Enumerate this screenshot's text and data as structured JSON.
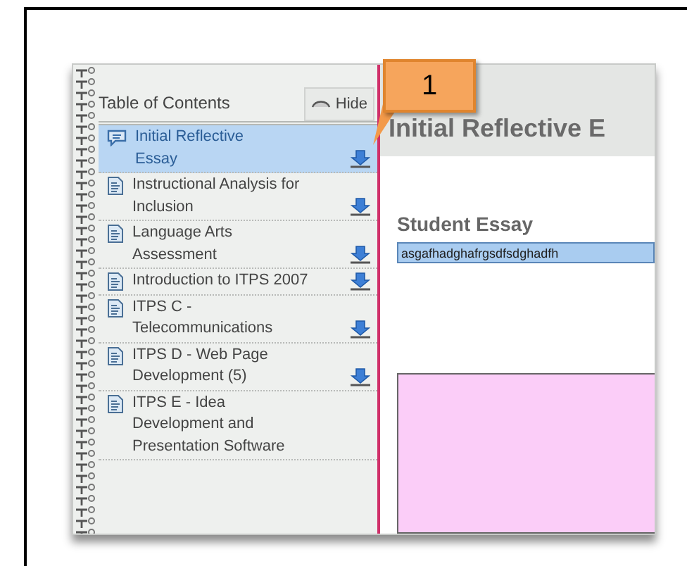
{
  "toc": {
    "title": "Table of Contents",
    "hide_button": "Hide",
    "items": [
      {
        "kind": "comment",
        "lines": [
          "Initial Reflective",
          "Essay"
        ],
        "selected": true,
        "download": true
      },
      {
        "kind": "document",
        "lines": [
          "Instructional Analysis for",
          "Inclusion"
        ],
        "selected": false,
        "download": true
      },
      {
        "kind": "document",
        "lines": [
          "Language Arts",
          "Assessment"
        ],
        "selected": false,
        "download": true
      },
      {
        "kind": "document",
        "lines": [
          "Introduction to ITPS 2007"
        ],
        "selected": false,
        "download": true
      },
      {
        "kind": "document",
        "lines": [
          "ITPS C -",
          "Telecommunications"
        ],
        "selected": false,
        "download": true
      },
      {
        "kind": "document",
        "lines": [
          "ITPS D - Web Page",
          "Development (5)"
        ],
        "selected": false,
        "download": true
      },
      {
        "kind": "document",
        "lines": [
          "ITPS E - Idea",
          "Development and",
          "Presentation Software"
        ],
        "selected": false,
        "download": false
      }
    ]
  },
  "callout": "1",
  "main": {
    "heading": "Initial Reflective E",
    "section_title": "Student Essay",
    "essay_value": "asgafhadghafrgsdfsdghadfh"
  }
}
